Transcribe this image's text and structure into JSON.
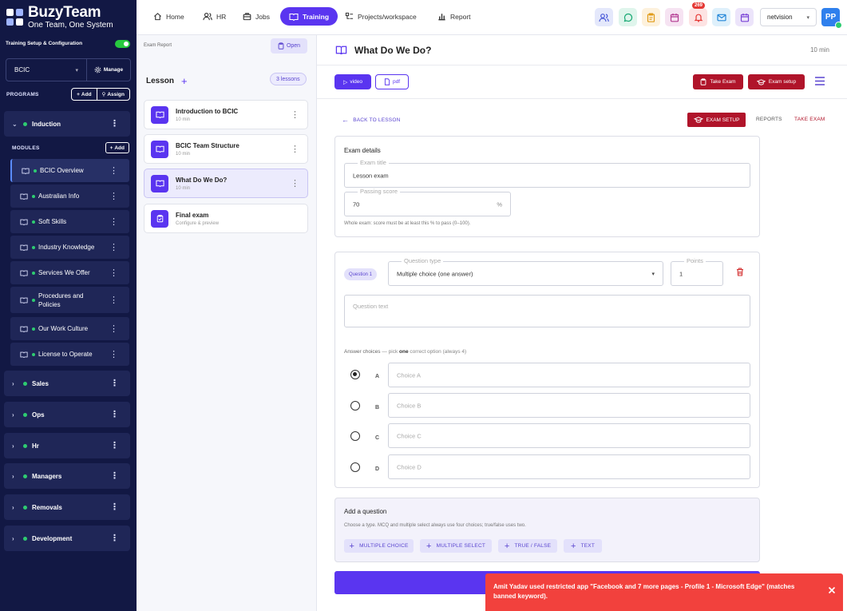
{
  "brand": {
    "name": "BuzyTeam",
    "tagline": "One Team, One System"
  },
  "sidebar": {
    "setup_label": "Training Setup & Configuration",
    "org_select": "BCIC",
    "manage_label": "Manage",
    "programs_label": "PROGRAMS",
    "add_label": "Add",
    "assign_label": "Assign",
    "modules_label": "MODULES",
    "module_add_label": "Add",
    "programs": [
      "Induction",
      "Sales",
      "Ops",
      "Hr",
      "Managers",
      "Removals",
      "Development"
    ],
    "modules": [
      "BCIC Overview",
      "Australian Info",
      "Soft Skills",
      "Industry Knowledge",
      "Services We Offer",
      "Procedures and Policies",
      "Our Work Culture",
      "License to Operate"
    ]
  },
  "topnav": {
    "items": [
      "Home",
      "HR",
      "Jobs",
      "Training",
      "Projects/workspace",
      "Report"
    ],
    "notif_count": "269",
    "workspace": "netvision",
    "avatar_initials": "PP"
  },
  "lessons": {
    "exam_report_label": "Exam Report",
    "open_label": "Open",
    "title": "Lesson",
    "count": "3 lessons",
    "items": [
      {
        "title": "Introduction to BCIC",
        "sub": "10 min"
      },
      {
        "title": "BCIC Team Structure",
        "sub": "10 min"
      },
      {
        "title": "What Do We Do?",
        "sub": "10 min"
      },
      {
        "title": "Final exam",
        "sub": "Configure & preview"
      }
    ]
  },
  "main": {
    "title": "What Do We Do?",
    "duration": "10 min",
    "video_label": "video",
    "pdf_label": "pdf",
    "take_exam_label": "Take Exam",
    "exam_setup_label": "Exam setup",
    "back_label": "BACK TO LESSON",
    "exam_setup_tab": "EXAM SETUP",
    "reports_tab": "REPORTS",
    "take_exam_tab": "TAKE EXAM",
    "exam_details": {
      "heading": "Exam details",
      "title_legend": "Exam title",
      "title_value": "Lesson exam",
      "score_legend": "Passing score",
      "score_value": "70",
      "score_unit": "%",
      "help": "Whole exam: score must be at least this % to pass (0–100)."
    },
    "question": {
      "badge": "Question 1",
      "type_legend": "Question type",
      "type_value": "Multiple choice (one answer)",
      "points_legend": "Points",
      "points_value": "1",
      "text_placeholder": "Question text",
      "choices_label": "Answer choices",
      "choices_hint_pre": " — pick ",
      "choices_hint_bold": "one",
      "choices_hint_post": " correct option (always 4)",
      "choices": [
        {
          "letter": "A",
          "placeholder": "Choice A"
        },
        {
          "letter": "B",
          "placeholder": "Choice B"
        },
        {
          "letter": "C",
          "placeholder": "Choice C"
        },
        {
          "letter": "D",
          "placeholder": "Choice D"
        }
      ]
    },
    "add_question": {
      "heading": "Add a question",
      "help": "Choose a type. MCQ and multiple select always use four choices; true/false uses two.",
      "buttons": [
        "MULTIPLE CHOICE",
        "MULTIPLE SELECT",
        "TRUE / FALSE",
        "TEXT"
      ]
    }
  },
  "toast": {
    "message": "Amit Yadav used restricted app \"Facebook and 7 more pages - Profile 1 - Microsoft Edge\" (matches banned keyword)."
  },
  "colors": {
    "accent": "#5a35f0",
    "danger": "#b0142a",
    "sidebar": "#121844",
    "toast": "#f2413d",
    "online": "#2ecc71"
  }
}
